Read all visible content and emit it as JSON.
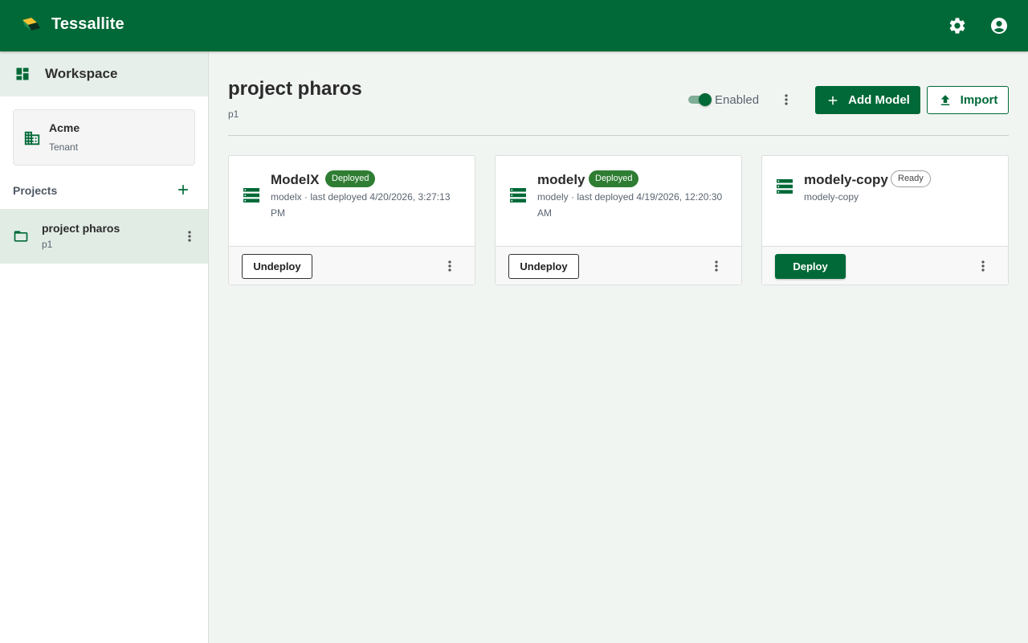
{
  "app": {
    "title": "Tessallite"
  },
  "colors": {
    "brand": "#006937",
    "deployed_badge": "#2e7d32",
    "content_bg": "#f1f5f2"
  },
  "topbar": {
    "icons": [
      "gear-icon",
      "account-circle-icon"
    ]
  },
  "sidebar": {
    "workspace_label": "Workspace",
    "tenant": {
      "name": "Acme",
      "subtitle": "Tenant"
    },
    "projects_label": "Projects",
    "projects": [
      {
        "name": "project pharos",
        "key": "p1"
      }
    ]
  },
  "main": {
    "title": "project pharos",
    "key": "p1",
    "toggle": {
      "label": "Enabled",
      "on": true
    },
    "add_model_label": "Add Model",
    "import_label": "Import",
    "models": [
      {
        "name": "ModelX",
        "status": "Deployed",
        "description": "modelx · last deployed 4/20/2026, 3:27:13 PM",
        "action": "Undeploy"
      },
      {
        "name": "modely",
        "status": "Deployed",
        "description": "modely · last deployed 4/19/2026, 12:20:30 AM",
        "action": "Undeploy"
      },
      {
        "name": "modely-copy",
        "status": "Ready",
        "description": "modely-copy",
        "action": "Deploy"
      }
    ]
  }
}
